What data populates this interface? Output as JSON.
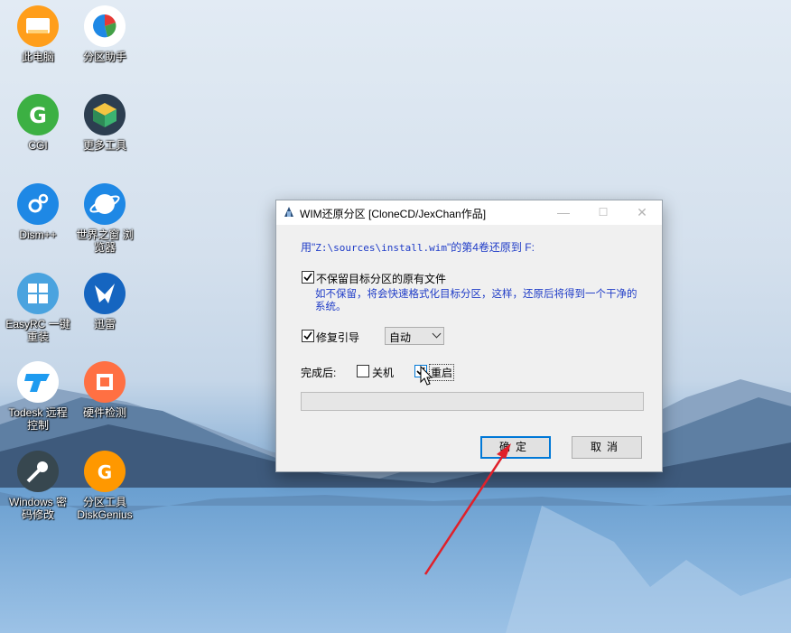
{
  "desktop": {
    "icons": [
      {
        "label": "此电脑",
        "icon": "this-pc-icon",
        "color": "#ff9e1b"
      },
      {
        "label": "分区助手",
        "icon": "partition-assistant-icon",
        "color": "#ffffff"
      },
      {
        "label": "CGI",
        "icon": "cgi-icon",
        "color": "#3cb043"
      },
      {
        "label": "更多工具",
        "icon": "more-tools-icon",
        "color": "#2c3e50"
      },
      {
        "label": "Dism++",
        "icon": "dism-icon",
        "color": "#1e88e5"
      },
      {
        "label": "世界之窗 浏\n览器",
        "icon": "browser-icon",
        "color": "#1e88e5"
      },
      {
        "label": "EasyRC 一键\n重装",
        "icon": "easyrc-icon",
        "color": "#4aa3df"
      },
      {
        "label": "迅雷",
        "icon": "thunder-icon",
        "color": "#1565c0"
      },
      {
        "label": "Todesk 远程\n控制",
        "icon": "todesk-icon",
        "color": "#ffffff"
      },
      {
        "label": "硬件检测",
        "icon": "hardware-check-icon",
        "color": "#ff7043"
      },
      {
        "label": "Windows 密\n码修改",
        "icon": "key-icon",
        "color": "#37474f"
      },
      {
        "label": "分区工具\nDiskGenius",
        "icon": "diskgenius-icon",
        "color": "#ff9800"
      }
    ]
  },
  "dialog": {
    "title": "WIM还原分区  [CloneCD/JexChan作品]",
    "restore_line_prefix": "用\"",
    "restore_path": "Z:\\sources\\install.wim",
    "restore_line_suffix": "\"的第4卷还原到 F:",
    "keep_files_label": "不保留目标分区的原有文件",
    "keep_files_checked": true,
    "keep_files_hint_1": "如不保留，将会快速格式化目标分区，这样，还原后将得到一个干净的",
    "keep_files_hint_2": "系统。",
    "repair_boot_label": "修复引导",
    "repair_boot_checked": true,
    "boot_mode_value": "自动",
    "after_label": "完成后:",
    "shutdown_label": "关机",
    "shutdown_checked": false,
    "restart_label": "重启",
    "restart_checked": true,
    "progress": 0,
    "ok_label": "确定",
    "cancel_label": "取消",
    "accent_color": "#1f3cc7"
  },
  "annotation": {
    "arrow_color": "#e0202a"
  }
}
